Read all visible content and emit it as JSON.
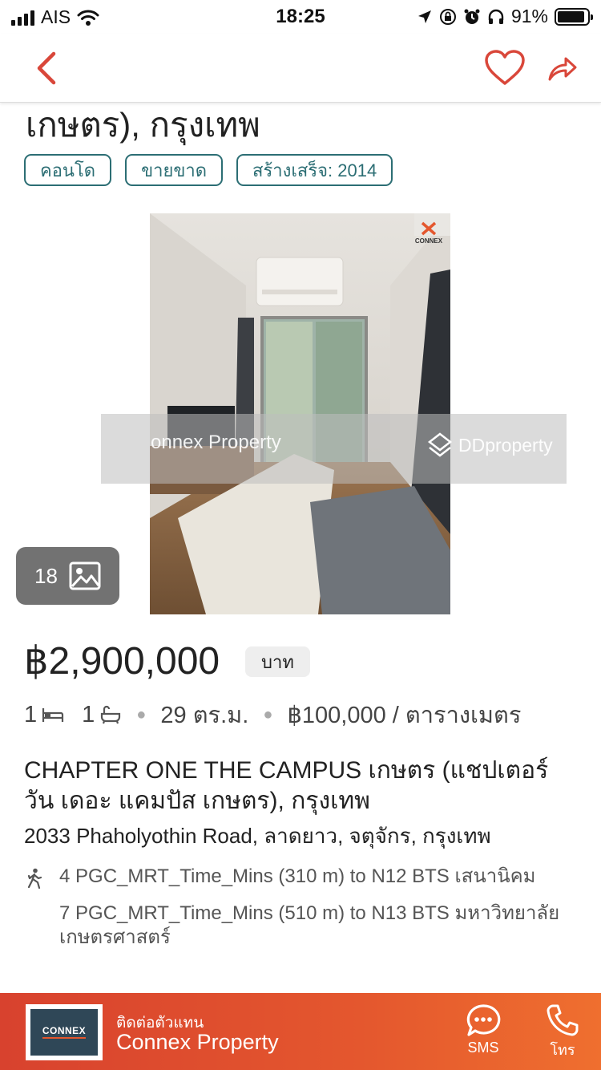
{
  "status_bar": {
    "carrier": "AIS",
    "time": "18:25",
    "battery_percent": "91%",
    "battery_level": 0.91
  },
  "nav": {
    "back_icon": "chevron-left-icon",
    "favorite_icon": "heart-outline-icon",
    "share_icon": "share-arrow-icon",
    "accent_color": "#d9473a"
  },
  "listing": {
    "title_partial": "เกษตร), กรุงเทพ",
    "tags": [
      "คอนโด",
      "ขายขาด",
      "สร้างเสร็จ: 2014"
    ],
    "photo_watermarks": {
      "left": "onnex Property",
      "right": "DDproperty",
      "corner_logo": "CONNEX"
    },
    "photo_count": "18",
    "price": "฿2,900,000",
    "currency_badge": "บาท",
    "bedrooms": "1",
    "bathrooms": "1",
    "area": "29 ตร.ม.",
    "price_per_area": "฿100,000 / ตารางเมตร",
    "project_name": "CHAPTER ONE THE CAMPUS เกษตร (แชปเตอร์ วัน เดอะ แคมปัส เกษตร), กรุงเทพ",
    "address": "2033 Phaholyothin Road, ลาดยาว, จตุจักร, กรุงเทพ",
    "transit": [
      "4 PGC_MRT_Time_Mins (310 m) to N12 BTS เสนานิคม",
      "7 PGC_MRT_Time_Mins (510 m) to N13 BTS มหาวิทยาลัยเกษตรศาสตร์"
    ]
  },
  "footer": {
    "logo_text": "CONNEX",
    "contact_label": "ติดต่อตัวแทน",
    "agent_name": "Connex Property",
    "sms_label": "SMS",
    "call_label": "โทร",
    "color": "#e4572e"
  }
}
